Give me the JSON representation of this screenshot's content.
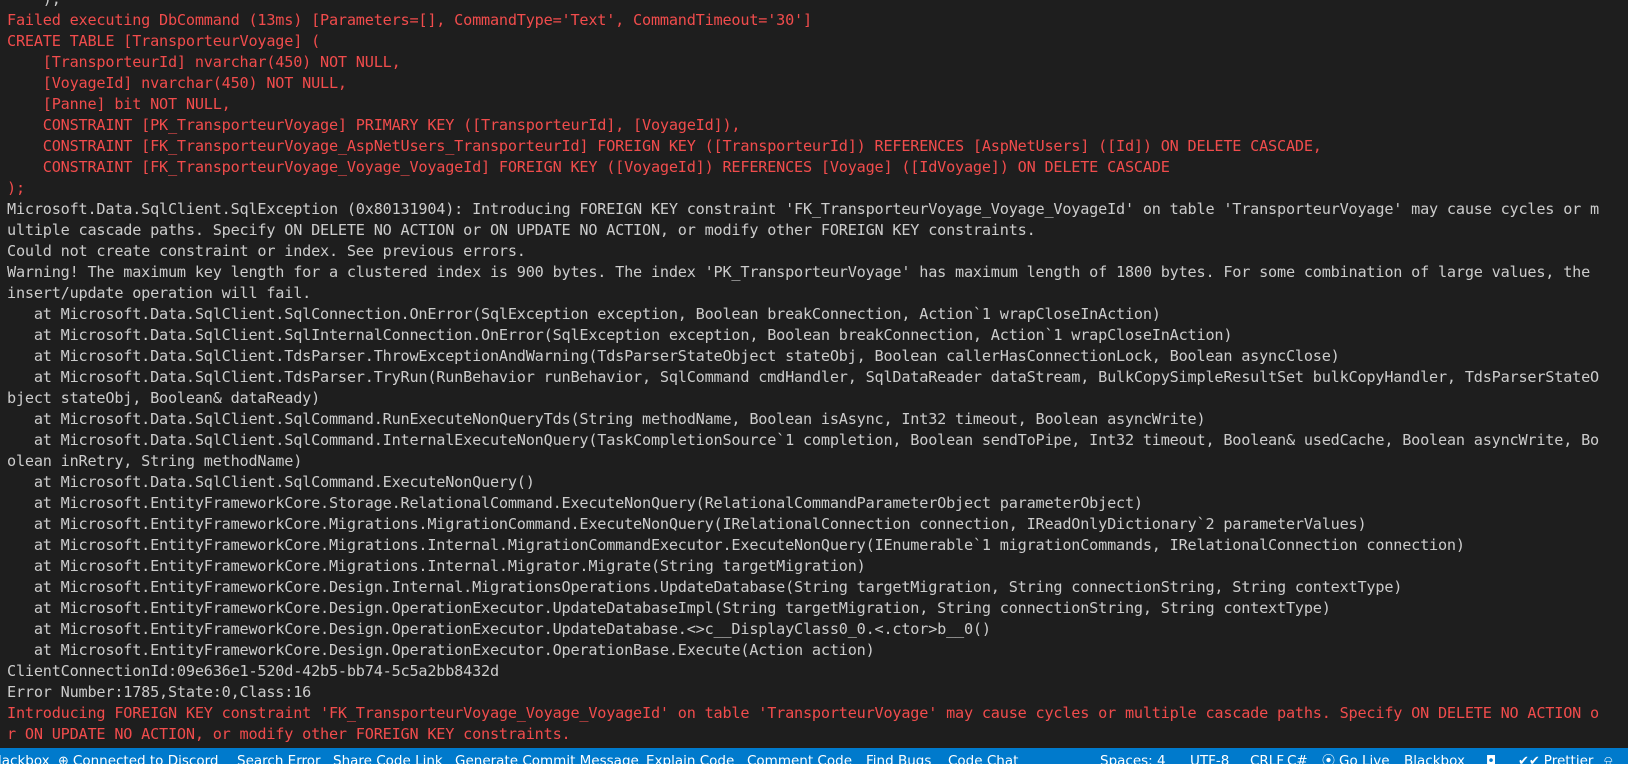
{
  "terminal": {
    "lines": [
      {
        "text": "    ),",
        "err": false
      },
      {
        "text": "Failed executing DbCommand (13ms) [Parameters=[], CommandType='Text', CommandTimeout='30']",
        "err": true
      },
      {
        "text": "CREATE TABLE [TransporteurVoyage] (",
        "err": true
      },
      {
        "text": "    [TransporteurId] nvarchar(450) NOT NULL,",
        "err": true
      },
      {
        "text": "    [VoyageId] nvarchar(450) NOT NULL,",
        "err": true
      },
      {
        "text": "    [Panne] bit NOT NULL,",
        "err": true
      },
      {
        "text": "    CONSTRAINT [PK_TransporteurVoyage] PRIMARY KEY ([TransporteurId], [VoyageId]),",
        "err": true
      },
      {
        "text": "    CONSTRAINT [FK_TransporteurVoyage_AspNetUsers_TransporteurId] FOREIGN KEY ([TransporteurId]) REFERENCES [AspNetUsers] ([Id]) ON DELETE CASCADE,",
        "err": true
      },
      {
        "text": "    CONSTRAINT [FK_TransporteurVoyage_Voyage_VoyageId] FOREIGN KEY ([VoyageId]) REFERENCES [Voyage] ([IdVoyage]) ON DELETE CASCADE",
        "err": true
      },
      {
        "text": ");",
        "err": true
      },
      {
        "text": "Microsoft.Data.SqlClient.SqlException (0x80131904): Introducing FOREIGN KEY constraint 'FK_TransporteurVoyage_Voyage_VoyageId' on table 'TransporteurVoyage' may cause cycles or m",
        "err": false
      },
      {
        "text": "ultiple cascade paths. Specify ON DELETE NO ACTION or ON UPDATE NO ACTION, or modify other FOREIGN KEY constraints.",
        "err": false
      },
      {
        "text": "Could not create constraint or index. See previous errors.",
        "err": false
      },
      {
        "text": "Warning! The maximum key length for a clustered index is 900 bytes. The index 'PK_TransporteurVoyage' has maximum length of 1800 bytes. For some combination of large values, the",
        "err": false
      },
      {
        "text": "insert/update operation will fail.",
        "err": false
      },
      {
        "text": "   at Microsoft.Data.SqlClient.SqlConnection.OnError(SqlException exception, Boolean breakConnection, Action`1 wrapCloseInAction)",
        "err": false
      },
      {
        "text": "   at Microsoft.Data.SqlClient.SqlInternalConnection.OnError(SqlException exception, Boolean breakConnection, Action`1 wrapCloseInAction)",
        "err": false
      },
      {
        "text": "   at Microsoft.Data.SqlClient.TdsParser.ThrowExceptionAndWarning(TdsParserStateObject stateObj, Boolean callerHasConnectionLock, Boolean asyncClose)",
        "err": false
      },
      {
        "text": "   at Microsoft.Data.SqlClient.TdsParser.TryRun(RunBehavior runBehavior, SqlCommand cmdHandler, SqlDataReader dataStream, BulkCopySimpleResultSet bulkCopyHandler, TdsParserStateO",
        "err": false
      },
      {
        "text": "bject stateObj, Boolean& dataReady)",
        "err": false
      },
      {
        "text": "   at Microsoft.Data.SqlClient.SqlCommand.RunExecuteNonQueryTds(String methodName, Boolean isAsync, Int32 timeout, Boolean asyncWrite)",
        "err": false
      },
      {
        "text": "   at Microsoft.Data.SqlClient.SqlCommand.InternalExecuteNonQuery(TaskCompletionSource`1 completion, Boolean sendToPipe, Int32 timeout, Boolean& usedCache, Boolean asyncWrite, Bo",
        "err": false
      },
      {
        "text": "olean inRetry, String methodName)",
        "err": false
      },
      {
        "text": "   at Microsoft.Data.SqlClient.SqlCommand.ExecuteNonQuery()",
        "err": false
      },
      {
        "text": "   at Microsoft.EntityFrameworkCore.Storage.RelationalCommand.ExecuteNonQuery(RelationalCommandParameterObject parameterObject)",
        "err": false
      },
      {
        "text": "   at Microsoft.EntityFrameworkCore.Migrations.MigrationCommand.ExecuteNonQuery(IRelationalConnection connection, IReadOnlyDictionary`2 parameterValues)",
        "err": false
      },
      {
        "text": "   at Microsoft.EntityFrameworkCore.Migrations.Internal.MigrationCommandExecutor.ExecuteNonQuery(IEnumerable`1 migrationCommands, IRelationalConnection connection)",
        "err": false
      },
      {
        "text": "   at Microsoft.EntityFrameworkCore.Migrations.Internal.Migrator.Migrate(String targetMigration)",
        "err": false
      },
      {
        "text": "   at Microsoft.EntityFrameworkCore.Design.Internal.MigrationsOperations.UpdateDatabase(String targetMigration, String connectionString, String contextType)",
        "err": false
      },
      {
        "text": "   at Microsoft.EntityFrameworkCore.Design.OperationExecutor.UpdateDatabaseImpl(String targetMigration, String connectionString, String contextType)",
        "err": false
      },
      {
        "text": "   at Microsoft.EntityFrameworkCore.Design.OperationExecutor.UpdateDatabase.<>c__DisplayClass0_0.<.ctor>b__0()",
        "err": false
      },
      {
        "text": "   at Microsoft.EntityFrameworkCore.Design.OperationExecutor.OperationBase.Execute(Action action)",
        "err": false
      },
      {
        "text": "ClientConnectionId:09e636e1-520d-42b5-bb74-5c5a2bb8432d",
        "err": false
      },
      {
        "text": "Error Number:1785,State:0,Class:16",
        "err": false
      },
      {
        "text": "Introducing FOREIGN KEY constraint 'FK_TransporteurVoyage_Voyage_VoyageId' on table 'TransporteurVoyage' may cause cycles or multiple cascade paths. Specify ON DELETE NO ACTION o",
        "err": true
      },
      {
        "text": "r ON UPDATE NO ACTION, or modify other FOREIGN KEY constraints.",
        "err": true
      }
    ]
  },
  "statusbar": {
    "background": "#007acc",
    "items": [
      {
        "name": "blackbox-left",
        "label": "lackbox",
        "icon": "",
        "icon_name": ""
      },
      {
        "name": "discord-status",
        "label": "Connected to Discord",
        "icon": "⊕",
        "icon_name": "globe-icon"
      },
      {
        "name": "search-error",
        "label": "Search Error",
        "icon": "",
        "icon_name": ""
      },
      {
        "name": "share-code-link",
        "label": "Share Code Link",
        "icon": "",
        "icon_name": ""
      },
      {
        "name": "generate-commit-message",
        "label": "Generate Commit Message",
        "icon": "",
        "icon_name": ""
      },
      {
        "name": "explain-code",
        "label": "Explain Code",
        "icon": "",
        "icon_name": ""
      },
      {
        "name": "comment-code",
        "label": "Comment Code",
        "icon": "",
        "icon_name": ""
      },
      {
        "name": "find-bugs",
        "label": "Find Bugs",
        "icon": "",
        "icon_name": ""
      },
      {
        "name": "code-chat",
        "label": "Code Chat",
        "icon": "",
        "icon_name": ""
      },
      {
        "name": "indentation",
        "label": "Spaces: 4",
        "icon": "",
        "icon_name": ""
      },
      {
        "name": "encoding",
        "label": "UTF-8",
        "icon": "",
        "icon_name": ""
      },
      {
        "name": "line-ending",
        "label": "CRLF",
        "icon": "",
        "icon_name": ""
      },
      {
        "name": "language-mode",
        "label": "C#",
        "icon": "",
        "icon_name": ""
      },
      {
        "name": "go-live",
        "label": "Go Live",
        "icon": "⦿",
        "icon_name": "broadcast-icon"
      },
      {
        "name": "blackbox-right",
        "label": "Blackbox",
        "icon": "",
        "icon_name": ""
      },
      {
        "name": "copilot",
        "label": "",
        "icon": "◘",
        "icon_name": "copilot-icon"
      },
      {
        "name": "prettier",
        "label": "Prettier",
        "icon": "✔✔",
        "icon_name": "double-check-icon"
      },
      {
        "name": "notifications",
        "label": "",
        "icon": "⍾",
        "icon_name": "bell-icon"
      }
    ]
  }
}
